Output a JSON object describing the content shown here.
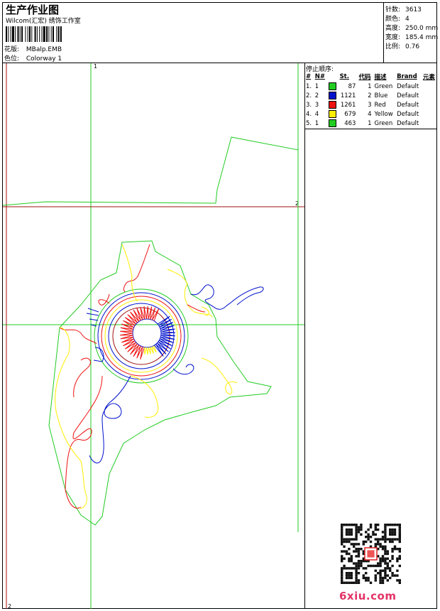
{
  "header": {
    "title": "生产作业图",
    "company": "Wilcom(汇宏) 绣饰工作室",
    "design_label": "花版:",
    "design_value": "MBalp.EMB",
    "colorway_label": "色位:",
    "colorway_value": "Colorway 1"
  },
  "stats": [
    {
      "label": "针数:",
      "value": "3613"
    },
    {
      "label": "颜色:",
      "value": "4"
    },
    {
      "label": "高度:",
      "value": "250.0 mm"
    },
    {
      "label": "宽度:",
      "value": "185.4 mm"
    },
    {
      "label": "比例:",
      "value": "0.76"
    }
  ],
  "stop_sequence": {
    "title": "停止顺序:",
    "headers": [
      "#",
      "N#",
      "St.",
      "代码",
      "描述",
      "Brand",
      "元素"
    ],
    "rows": [
      {
        "num": "1.",
        "n": "1",
        "color": "#22cc22",
        "stitches": "87",
        "code": "1",
        "desc": "Green",
        "brand": "Default"
      },
      {
        "num": "2.",
        "n": "2",
        "color": "#0011cc",
        "stitches": "1121",
        "code": "2",
        "desc": "Blue",
        "brand": "Default"
      },
      {
        "num": "3.",
        "n": "3",
        "color": "#ee1111",
        "stitches": "1261",
        "code": "3",
        "desc": "Red",
        "brand": "Default"
      },
      {
        "num": "4.",
        "n": "4",
        "color": "#ffee00",
        "stitches": "679",
        "code": "4",
        "desc": "Yellow",
        "brand": "Default"
      },
      {
        "num": "5.",
        "n": "1",
        "color": "#22cc22",
        "stitches": "463",
        "code": "1",
        "desc": "Green",
        "brand": "Default"
      }
    ]
  },
  "guides": {
    "v1_label": "1",
    "h2_label": "2",
    "bottom_label": "2"
  },
  "watermark": "6xiu.com",
  "colors": {
    "green": "#22cc22",
    "blue": "#0011cc",
    "red": "#ee1111",
    "yellow": "#ffee00",
    "guide_red": "#a01010"
  }
}
